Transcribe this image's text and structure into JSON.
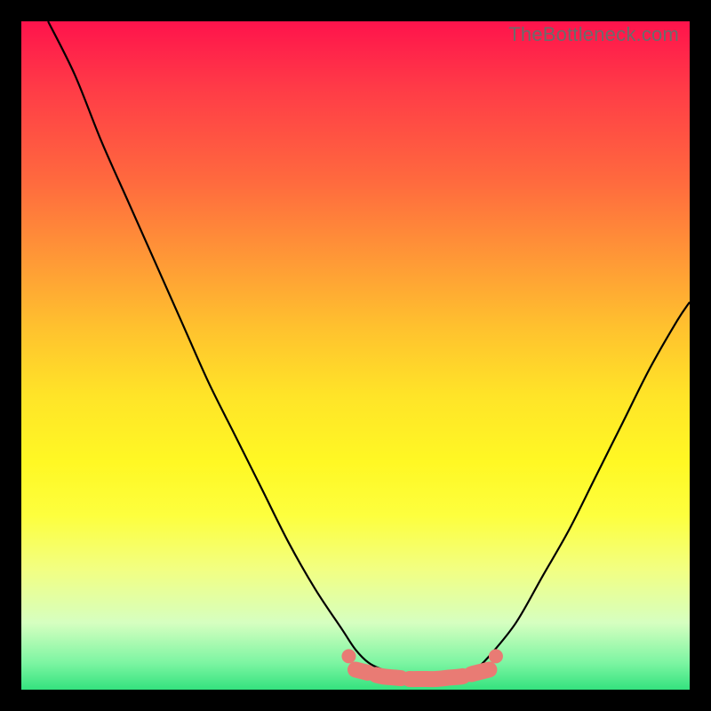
{
  "watermark": "TheBottleneck.com",
  "chart_data": {
    "type": "line",
    "title": "",
    "xlabel": "",
    "ylabel": "",
    "xlim": [
      0,
      100
    ],
    "ylim": [
      0,
      100
    ],
    "series": [
      {
        "name": "curve-left",
        "x": [
          4,
          8,
          12,
          16,
          20,
          24,
          28,
          32,
          36,
          40,
          44,
          48,
          50,
          52,
          54
        ],
        "y": [
          100,
          92,
          82,
          73,
          64,
          55,
          46,
          38,
          30,
          22,
          15,
          9,
          6,
          4,
          3
        ]
      },
      {
        "name": "curve-right",
        "x": [
          68,
          70,
          74,
          78,
          82,
          86,
          90,
          94,
          98,
          100
        ],
        "y": [
          3,
          5,
          10,
          17,
          24,
          32,
          40,
          48,
          55,
          58
        ]
      },
      {
        "name": "baseline-markers",
        "x": [
          50,
          52,
          54,
          56,
          58,
          60,
          62,
          64,
          66,
          68,
          70
        ],
        "y": [
          3,
          2.5,
          2,
          1.8,
          1.6,
          1.6,
          1.6,
          1.8,
          2,
          2.5,
          3
        ]
      }
    ]
  },
  "colors": {
    "curve": "#000000",
    "markers": "#e97b74",
    "frame": "#000000"
  }
}
